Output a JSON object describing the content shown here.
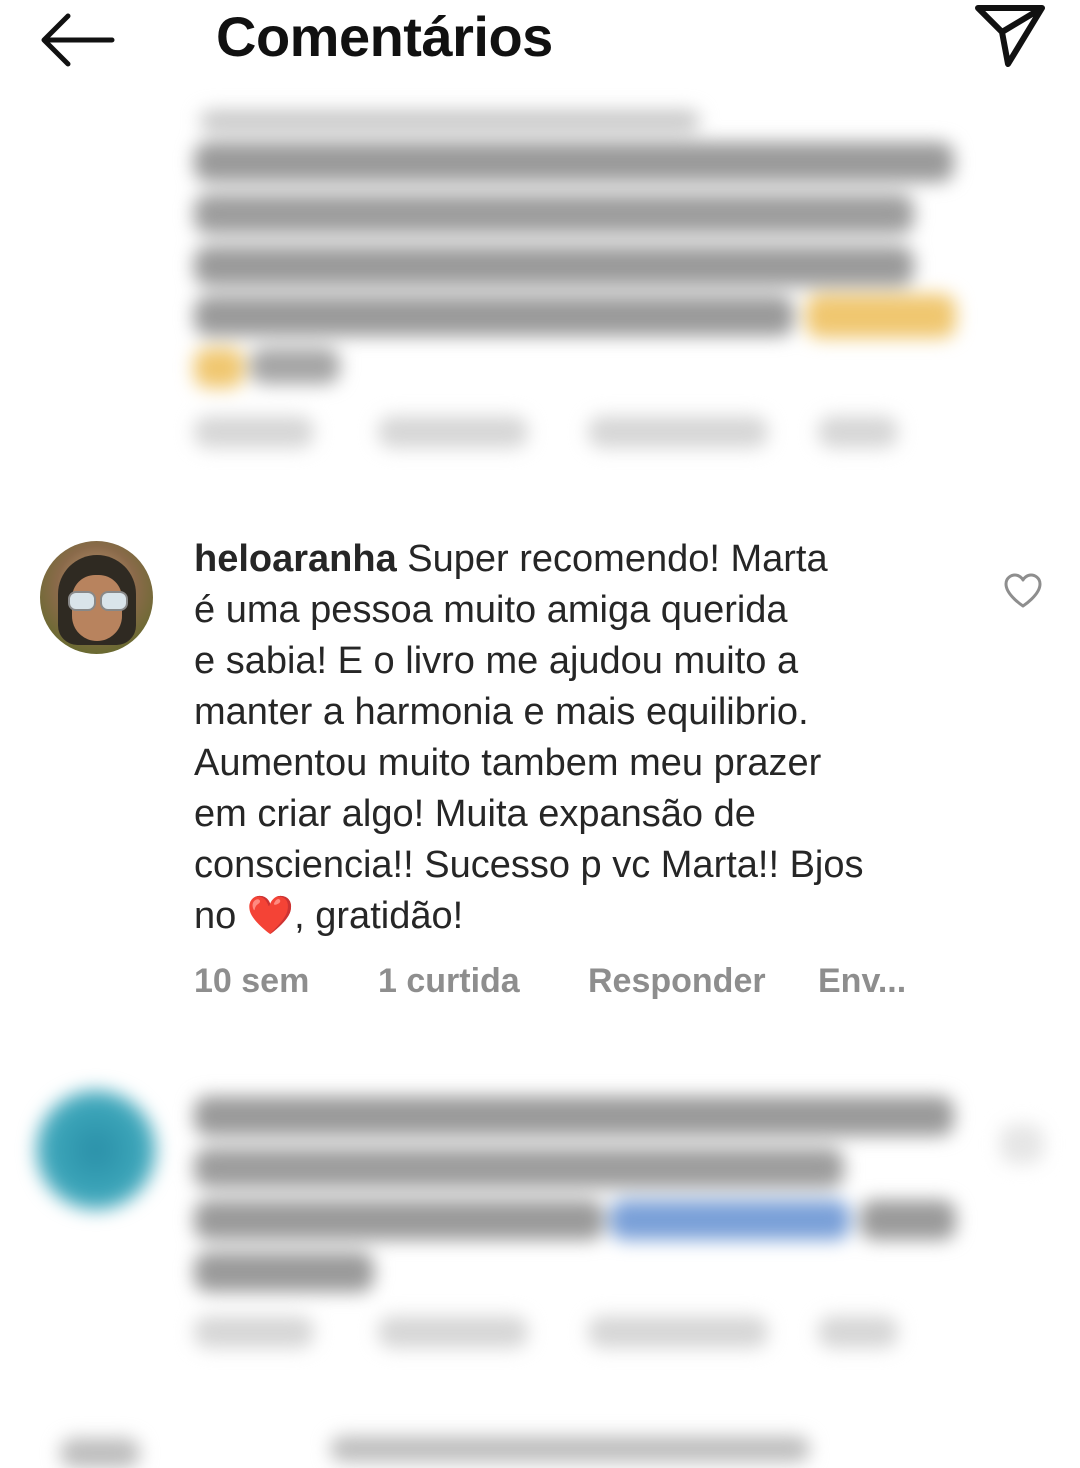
{
  "header": {
    "title": "Comentários"
  },
  "comment": {
    "username": "heloaranha",
    "text_lines": [
      " Super recomendo! Marta",
      "é uma pessoa muito amiga querida",
      "e sabia! E o livro me ajudou muito a",
      "manter a harmonia e mais equilibrio.",
      "Aumentou muito tambem meu prazer",
      "em criar algo! Muita expansão de",
      "consciencia!! Sucesso p vc Marta!! Bjos"
    ],
    "last_line_start": "no ",
    "emoji": "❤️",
    "last_line_end": ", gratidão!",
    "time": "10 sem",
    "likes": "1 curtida",
    "reply": "Responder",
    "send": "Env..."
  },
  "colors": {
    "meta_text": "#8e8e8e",
    "text": "#262626",
    "heart": "#e0142d"
  },
  "icons": [
    "back-arrow-icon",
    "send-icon",
    "heart-outline-icon"
  ]
}
